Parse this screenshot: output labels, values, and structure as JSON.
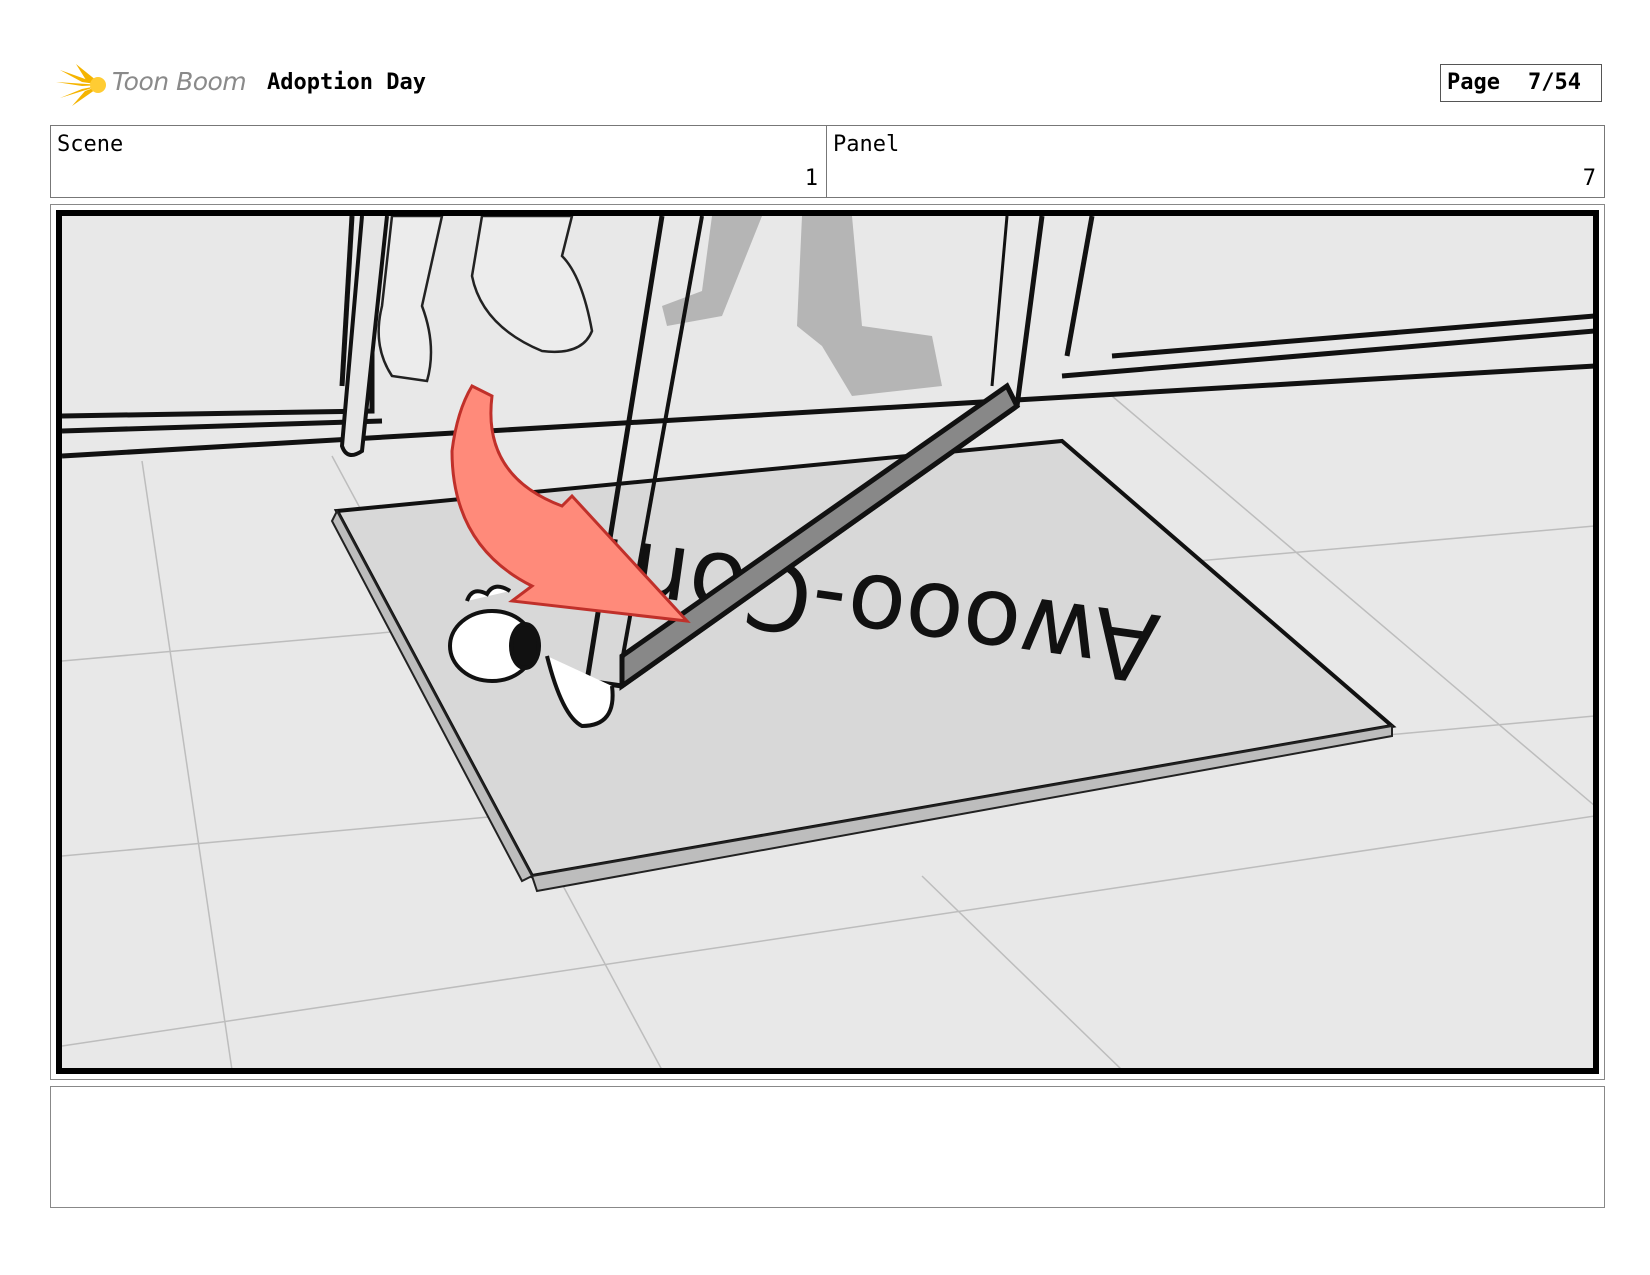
{
  "header": {
    "brand": "Toon Boom",
    "project_title": "Adoption Day",
    "page_label": "Page",
    "page_number": "7/54"
  },
  "info": {
    "scene_label": "Scene",
    "scene_value": "1",
    "panel_label": "Panel",
    "panel_value": "7"
  },
  "drawing": {
    "doormat_text": "Awooo-Com",
    "arrow_color": "#ff8a7a",
    "arrow_outline": "#c0302a"
  },
  "notes": {
    "text": ""
  }
}
